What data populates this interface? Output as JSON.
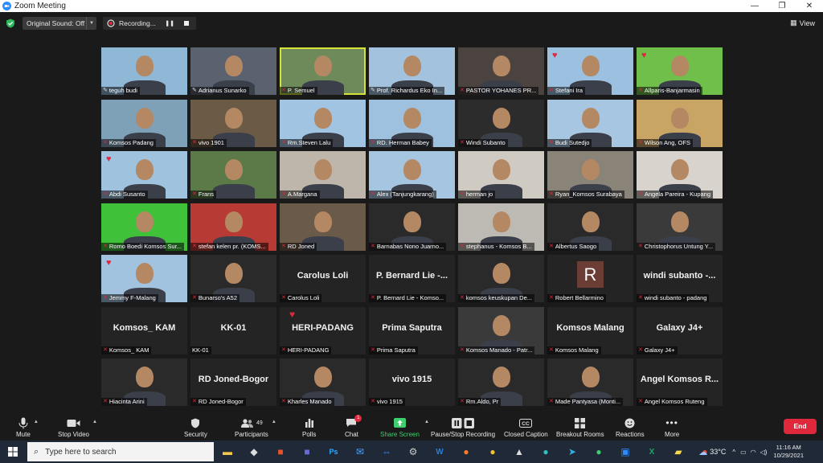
{
  "window": {
    "title": "Zoom Meeting",
    "controls": [
      "—",
      "❐",
      "✕"
    ]
  },
  "topbar": {
    "original_sound": "Original Sound: Off",
    "recording": "Recording...",
    "view": "View"
  },
  "participants": [
    {
      "name": "teguh budi",
      "type": "video",
      "color": "#8fb7d6",
      "icon": "pin"
    },
    {
      "name": "Adrianus Sunarko",
      "type": "video",
      "color": "#5a6270",
      "icon": "pin"
    },
    {
      "name": "P. Semuel",
      "type": "video",
      "color": "#6e8a5a",
      "icon": "mute",
      "spotlight": true
    },
    {
      "name": "Prof. Richardus Eko In...",
      "type": "video",
      "color": "#a3c2dd",
      "icon": "pin"
    },
    {
      "name": "PASTOR YOHANES PR...",
      "type": "video",
      "color": "#4a4340",
      "icon": "mute"
    },
    {
      "name": "Stefani Ira",
      "type": "video",
      "color": "#9cc0e0",
      "icon": "mute",
      "heart": true
    },
    {
      "name": "Allparis-Banjarmasin",
      "type": "video",
      "color": "#6fbf4a",
      "icon": "mute",
      "heart": true
    },
    {
      "name": "Komsos Padang",
      "type": "video",
      "color": "#7fa1b8",
      "icon": "mute"
    },
    {
      "name": "vivo 1901",
      "type": "video",
      "color": "#6b5a45",
      "icon": "mute"
    },
    {
      "name": "Rm.Steven Lalu",
      "type": "video",
      "color": "#a0c4e2",
      "icon": "mute"
    },
    {
      "name": "RD. Herman Babey",
      "type": "video",
      "color": "#9ec1df",
      "icon": "mute"
    },
    {
      "name": "Windi Subanto",
      "type": "video",
      "color": "#2c2c2c",
      "icon": "mute"
    },
    {
      "name": "Budi Sutedjo",
      "type": "video",
      "color": "#a6c6e2",
      "icon": "mute"
    },
    {
      "name": "Wilson Ang, OFS",
      "type": "video",
      "color": "#c8a565",
      "icon": "mute"
    },
    {
      "name": "Abdi Susanto",
      "type": "video",
      "color": "#9fc2df",
      "icon": "mute",
      "heart": true
    },
    {
      "name": "Frans",
      "type": "video",
      "color": "#5b7a48",
      "icon": "mute"
    },
    {
      "name": "A.Margana",
      "type": "video",
      "color": "#bfb6ab",
      "icon": "mute"
    },
    {
      "name": "Alex (Tanjungkarang)",
      "type": "video",
      "color": "#a5c5e0",
      "icon": "mute"
    },
    {
      "name": "herman jo",
      "type": "video",
      "color": "#cfcac2",
      "icon": "mute"
    },
    {
      "name": "Ryan_Komsos Surabaya",
      "type": "video",
      "color": "#8a8478",
      "icon": "mute"
    },
    {
      "name": "Angela Pareira - Kupang",
      "type": "video",
      "color": "#d8d3cd",
      "icon": "mute"
    },
    {
      "name": "Romo Boedi Komsos Sur...",
      "type": "video",
      "color": "#3fc23a",
      "icon": "mute"
    },
    {
      "name": "stefan kelen pr. (KOMS...",
      "type": "video",
      "color": "#b83a35",
      "icon": "mute"
    },
    {
      "name": "RD Joned",
      "type": "video",
      "color": "#6a5a4a",
      "icon": "mute"
    },
    {
      "name": "Barnabas Nono Juarno...",
      "type": "video",
      "color": "#2a2a2a",
      "icon": "mute"
    },
    {
      "name": "stephanus - Komsos B...",
      "type": "video",
      "color": "#bdbab4",
      "icon": "mute"
    },
    {
      "name": "Albertus Saogo",
      "type": "video",
      "color": "#2a2a2a",
      "icon": "mute"
    },
    {
      "name": "Christophorus Untung Y...",
      "type": "video",
      "color": "#3a3a3a",
      "icon": "mute"
    },
    {
      "name": "Jemmy F-Malang",
      "type": "video",
      "color": "#a2c3e0",
      "icon": "mute",
      "heart": true
    },
    {
      "name": "Bunarso's A52",
      "type": "video",
      "color": "#2a2a2a",
      "icon": "mute"
    },
    {
      "name": "Carolus Loli",
      "type": "name",
      "display": "Carolus Loli",
      "icon": "mute"
    },
    {
      "name": "P. Bernard Lie - Komso...",
      "type": "name",
      "display": "P. Bernard Lie -...",
      "icon": "mute"
    },
    {
      "name": "komsos keuskupan De...",
      "type": "video",
      "color": "#2a2a2a",
      "icon": "mute"
    },
    {
      "name": "Robert Bellarmino",
      "type": "avatar",
      "letter": "R",
      "icon": "mute"
    },
    {
      "name": "windi subanto - padang",
      "type": "name",
      "display": "windi subanto -...",
      "icon": "mute"
    },
    {
      "name": "Komsos_ KAM",
      "type": "name",
      "display": "Komsos_ KAM",
      "icon": "mute"
    },
    {
      "name": "KK-01",
      "type": "name",
      "display": "KK-01",
      "icon": "none"
    },
    {
      "name": "HERI-PADANG",
      "type": "name",
      "display": "HERI-PADANG",
      "icon": "mute",
      "heart": true
    },
    {
      "name": "Prima Saputra",
      "type": "name",
      "display": "Prima Saputra",
      "icon": "mute"
    },
    {
      "name": "Komsos Manado - Patr...",
      "type": "video",
      "color": "#3a3a3a",
      "icon": "mute"
    },
    {
      "name": "Komsos Malang",
      "type": "name",
      "display": "Komsos Malang",
      "icon": "mute"
    },
    {
      "name": "Galaxy J4+",
      "type": "name",
      "display": "Galaxy J4+",
      "icon": "mute"
    },
    {
      "name": "Hiacinta Arini",
      "type": "video",
      "color": "#2a2a2a",
      "icon": "mute"
    },
    {
      "name": "RD Joned-Bogor",
      "type": "name",
      "display": "RD Joned-Bogor",
      "icon": "mute"
    },
    {
      "name": "Kharles Manado",
      "type": "video",
      "color": "#2a2a2a",
      "icon": "mute"
    },
    {
      "name": "vivo 1915",
      "type": "name",
      "display": "vivo 1915",
      "icon": "mute"
    },
    {
      "name": "Rm.Aldo, Pr",
      "type": "video",
      "color": "#2a2a2a",
      "icon": "mute"
    },
    {
      "name": "Made Pantyasa (Monti...",
      "type": "video",
      "color": "#2a2a2a",
      "icon": "mute"
    },
    {
      "name": "Angel Komsos Ruteng",
      "type": "name",
      "display": "Angel Komsos R...",
      "icon": "mute"
    }
  ],
  "toolbar": {
    "mute": "Mute",
    "stop_video": "Stop Video",
    "security": "Security",
    "participants": "Participants",
    "participants_count": "49",
    "polls": "Polls",
    "chat": "Chat",
    "chat_badge": "1",
    "share_screen": "Share Screen",
    "pause_recording": "Pause/Stop Recording",
    "closed_caption": "Closed Caption",
    "breakout_rooms": "Breakout Rooms",
    "reactions": "Reactions",
    "more": "More",
    "end": "End"
  },
  "taskbar": {
    "search_placeholder": "Type here to search",
    "temperature": "33°C",
    "time": "11:16 AM",
    "date": "10/29/2021"
  },
  "colors": {
    "accent_blue": "#2d8cff",
    "end_red": "#e0283c",
    "share_green": "#3ecf6e",
    "spotlight": "#d6e23a"
  }
}
